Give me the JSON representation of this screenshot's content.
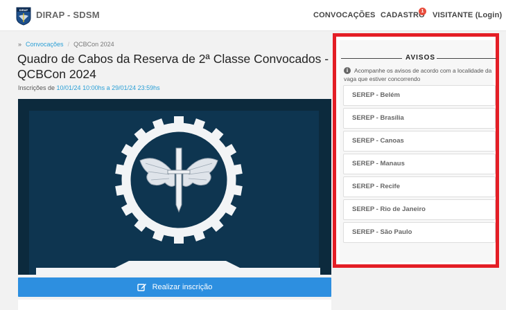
{
  "header": {
    "brand": "DIRAP - SDSM",
    "logo_text": "DIRAP",
    "nav": {
      "convocacoes": "CONVOCAÇÕES",
      "cadastro": "CADASTRO",
      "cadastro_badge": "1",
      "visitante": "VISITANTE (Login)"
    }
  },
  "breadcrumb": {
    "lead": "»",
    "link": "Convocações",
    "separator": "/",
    "current": "QCBCon 2024"
  },
  "page_title": "Quadro de Cabos da Reserva de 2ª Classe Convocados - QCBCon 2024",
  "inscricoes": {
    "prefix": "Inscrições de ",
    "range": "10/01/24 10:00hs a 29/01/24 23:59hs"
  },
  "action_button": {
    "label": "Realizar inscrição",
    "icon": "edit-icon"
  },
  "avisos": {
    "title": "AVISOS",
    "info_icon": "info-icon",
    "info_text": "Acompanhe os avisos de acordo com a localidade da vaga que estiver concorrendo",
    "regions": [
      "SEREP - Belém",
      "SEREP - Brasília",
      "SEREP - Canoas",
      "SEREP - Manaus",
      "SEREP - Recife",
      "SEREP - Rio de Janeiro",
      "SEREP - São Paulo"
    ]
  },
  "colors": {
    "accent_link": "#2a9fd6",
    "button": "#2d8fe0",
    "highlight_border": "#e41e26",
    "banner_bg": "#0c2a3d",
    "badge": "#e74c3c"
  }
}
